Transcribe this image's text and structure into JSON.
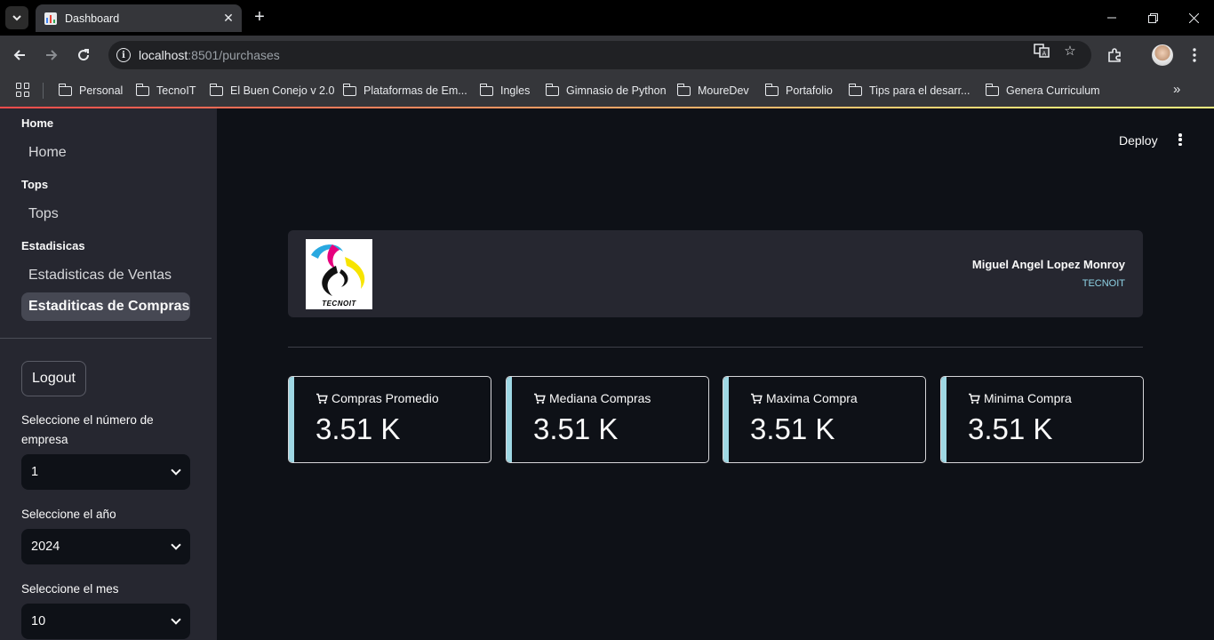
{
  "browser": {
    "tab_title": "Dashboard",
    "url_host": "localhost",
    "url_rest": ":8501/purchases",
    "bookmarks": [
      "Personal",
      "TecnoIT",
      "El Buen Conejo v 2.0",
      "Plataformas de Em...",
      "Ingles",
      "Gimnasio de Python",
      "MoureDev",
      "Portafolio",
      "Tips para el desarr...",
      "Genera Curriculum"
    ]
  },
  "sidebar": {
    "sections": [
      {
        "title": "Home",
        "link": "Home"
      },
      {
        "title": "Tops",
        "link": "Tops"
      },
      {
        "title": "Estadisicas",
        "links": [
          "Estadisticas de Ventas",
          "Estaditicas de Compras"
        ]
      }
    ],
    "active_link": "Estaditicas de Compras",
    "logout_label": "Logout",
    "filters": [
      {
        "label": "Seleccione el número de empresa",
        "value": "1"
      },
      {
        "label": "Seleccione el año",
        "value": "2024"
      },
      {
        "label": "Seleccione el mes",
        "value": "10"
      }
    ]
  },
  "header": {
    "deploy_label": "Deploy",
    "logo_text": "TECNOIT",
    "user_name": "Miguel Angel Lopez Monroy",
    "company": "TECNOIT"
  },
  "metrics": [
    {
      "label": "Compras Promedio",
      "value": "3.51 K"
    },
    {
      "label": "Mediana Compras",
      "value": "3.51 K"
    },
    {
      "label": "Maxima Compra",
      "value": "3.51 K"
    },
    {
      "label": "Minima Compra",
      "value": "3.51 K"
    }
  ],
  "colors": {
    "background": "#0e1117",
    "sidebar": "#262730",
    "metric_accent": "#9fd8e4",
    "company_text": "#8fd3e6"
  }
}
